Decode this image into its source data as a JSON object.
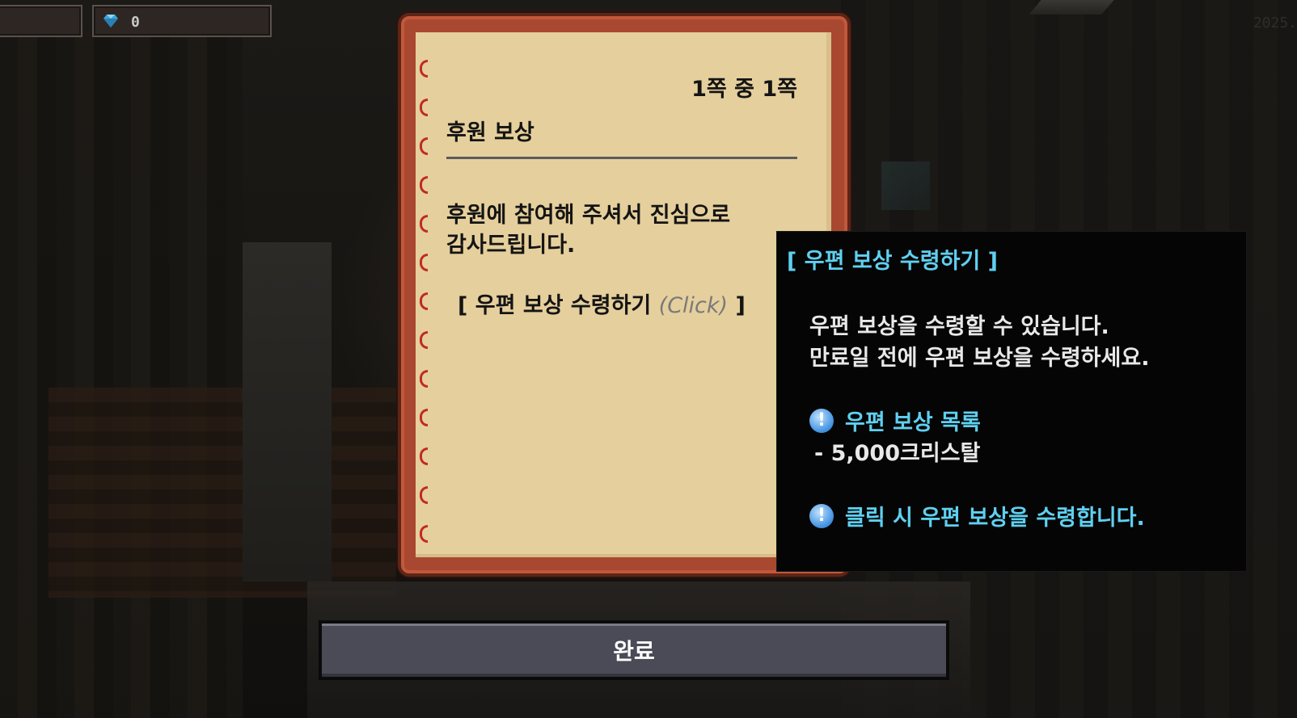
{
  "hud": {
    "currency_icon": "diamond-gem-icon",
    "currency_value": "0",
    "version_text": "2025."
  },
  "book": {
    "page_indicator": "1쪽 중 1쪽",
    "title": "후원 보상",
    "body_lines": [
      "후원에 참여해 주셔서 진심으로",
      "감사드립니다."
    ],
    "claim_link_label": "[ 우편 보상 수령하기",
    "claim_link_hint": "(Click)",
    "claim_link_close": "]"
  },
  "tooltip": {
    "title": "[ 우편 보상 수령하기 ]",
    "description_lines": [
      "우편 보상을 수령할 수 있습니다.",
      "만료일 전에 우편 보상을 수령하세요."
    ],
    "list_heading": "우편 보상 목록",
    "list_items": [
      "- 5,000크리스탈"
    ],
    "footer_note": "클릭 시 우편 보상을 수령합니다.",
    "info_icon_glyph": "!",
    "accent_color": "#5fd0f0"
  },
  "actions": {
    "done_label": "완료"
  }
}
